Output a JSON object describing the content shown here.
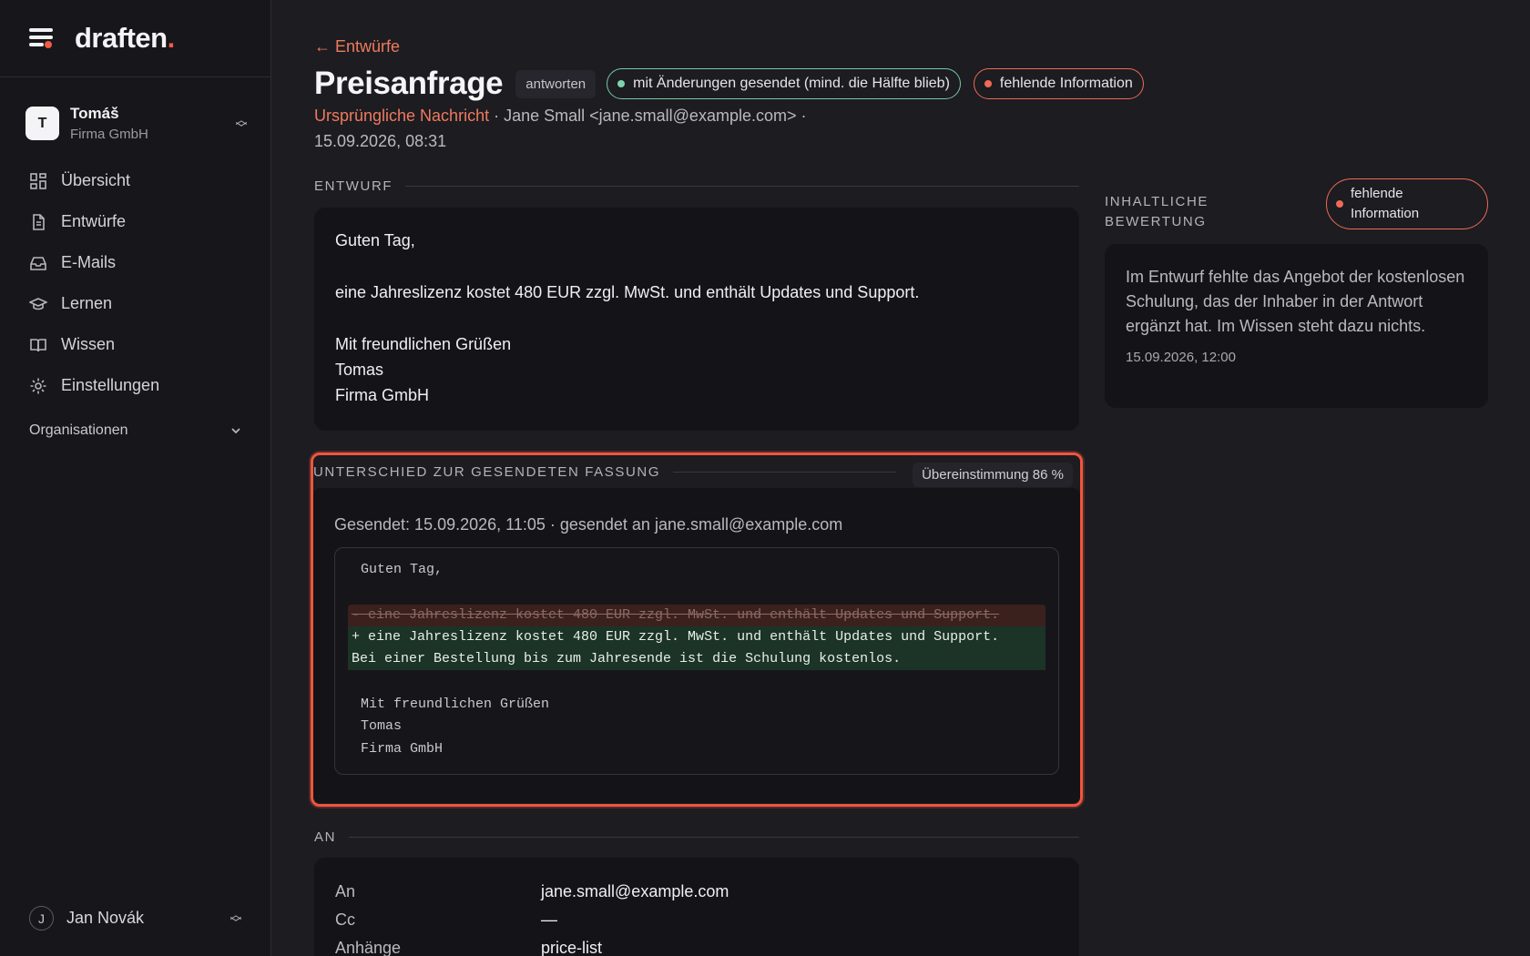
{
  "brand": {
    "name": "draften",
    "accent": "."
  },
  "account": {
    "initial": "T",
    "name": "Tomáš",
    "org": "Firma GmbH"
  },
  "nav": [
    {
      "label": "Übersicht",
      "icon": "dashboard-icon"
    },
    {
      "label": "Entwürfe",
      "icon": "document-icon"
    },
    {
      "label": "E-Mails",
      "icon": "inbox-icon"
    },
    {
      "label": "Lernen",
      "icon": "graduation-cap-icon"
    },
    {
      "label": "Wissen",
      "icon": "book-icon"
    },
    {
      "label": "Einstellungen",
      "icon": "gear-icon"
    }
  ],
  "organisations_label": "Organisationen",
  "user": {
    "initial": "J",
    "name": "Jan Novák"
  },
  "header": {
    "back": "← Entwürfe",
    "title": "Preisanfrage",
    "tag": "antworten",
    "status_sent": "mit Änderungen gesendet (mind. die Hälfte blieb)",
    "status_missing": "fehlende Information",
    "meta_original": "Ursprüngliche Nachricht",
    "meta_from": " · Jane Small <jane.small@example.com> ·",
    "meta_date": "15.09.2026, 08:31"
  },
  "draft": {
    "heading": "ENTWURF",
    "lines": [
      "Guten Tag,",
      "eine Jahreslizenz kostet 480 EUR zzgl. MwSt. und enthält Updates und Support.",
      "Mit freundlichen Grüßen",
      "Tomas",
      "Firma GmbH"
    ]
  },
  "diff": {
    "heading": "UNTERSCHIED ZUR GESENDETEN FASSUNG",
    "match": "Übereinstimmung 86 %",
    "sent": "Gesendet: 15.09.2026, 11:05 · gesendet an jane.small@example.com",
    "lines": [
      {
        "type": "ctx",
        "text": "Guten Tag,"
      },
      {
        "type": "ctx",
        "text": ""
      },
      {
        "type": "del",
        "text": "- eine Jahreslizenz kostet 480 EUR zzgl. MwSt. und enthält Updates und Support."
      },
      {
        "type": "add",
        "text": "+ eine Jahreslizenz kostet 480 EUR zzgl. MwSt. und enthält Updates und Support."
      },
      {
        "type": "add",
        "text": "Bei einer Bestellung bis zum Jahresende ist die Schulung kostenlos."
      },
      {
        "type": "ctx",
        "text": ""
      },
      {
        "type": "ctx",
        "text": "Mit freundlichen Grüßen"
      },
      {
        "type": "ctx",
        "text": "Tomas"
      },
      {
        "type": "ctx",
        "text": "Firma GmbH"
      }
    ]
  },
  "evaluation": {
    "heading_1": "INHALTLICHE",
    "heading_2": "BEWERTUNG",
    "pill_1": "fehlende",
    "pill_2": "Information",
    "text": "Im Entwurf fehlte das Angebot der kostenlosen Schulung, das der Inhaber in der Antwort ergänzt hat. Im Wissen steht dazu nichts.",
    "time": "15.09.2026, 12:00"
  },
  "recipients": {
    "heading": "AN",
    "rows": [
      {
        "key": "An",
        "value": "jane.small@example.com"
      },
      {
        "key": "Cc",
        "value": "—"
      },
      {
        "key": "Anhänge",
        "value": "price-list"
      }
    ]
  },
  "colors": {
    "accent": "#ef5b45",
    "link": "#ef7a5e",
    "positive": "#7dd3ae"
  }
}
